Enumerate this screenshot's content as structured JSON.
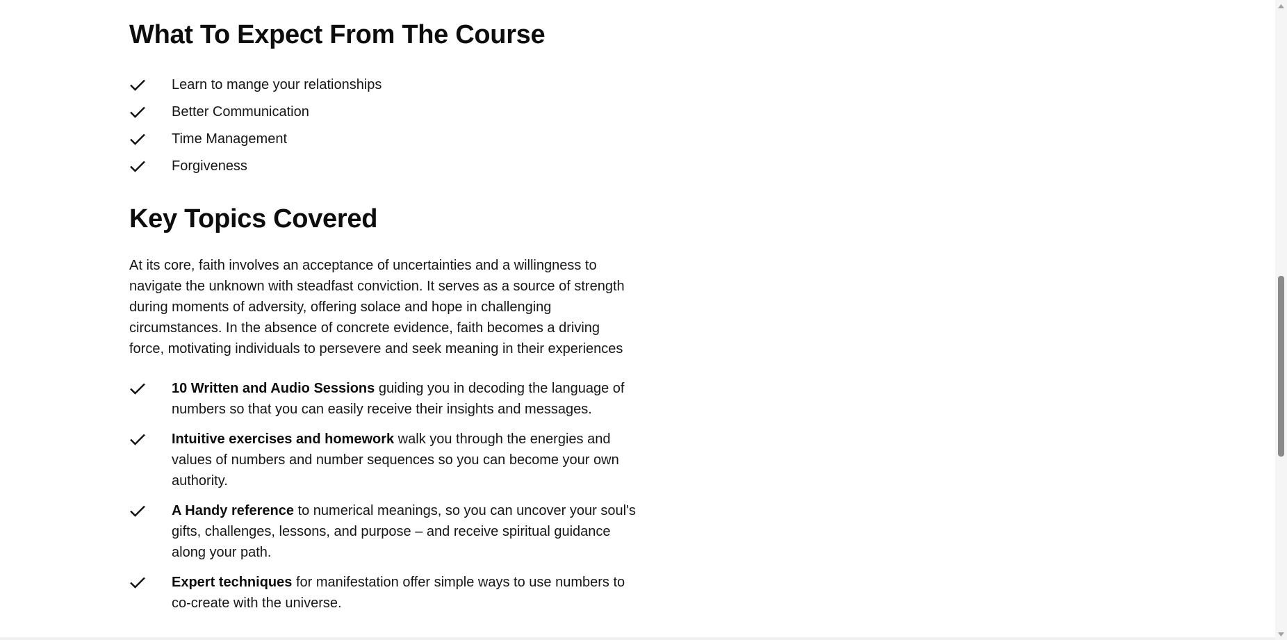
{
  "expect_section": {
    "title": "What To Expect From The Course",
    "items": [
      "Learn to mange your relationships",
      "Better Communication",
      "Time Management",
      "Forgiveness"
    ]
  },
  "topics_section": {
    "title": "Key Topics Covered",
    "intro": "At its core, faith involves an acceptance of uncertainties and a willingness to navigate the unknown with steadfast conviction. It serves as a source of strength during moments of adversity, offering solace and hope in challenging circumstances. In the absence of concrete evidence, faith becomes a driving force, motivating individuals to persevere and seek meaning in their experiences",
    "items": [
      {
        "bold": "10 Written and Audio Sessions",
        "text": " guiding you in decoding the language of numbers so that you can easily receive their insights and messages."
      },
      {
        "bold": "Intuitive exercises and homework",
        "text": " walk you through the energies and values of numbers and number sequences so you can become your own authority."
      },
      {
        "bold": "A Handy reference",
        "text": " to numerical meanings, so you can uncover your soul's gifts, challenges, lessons, and purpose – and receive spiritual guidance along your path."
      },
      {
        "bold": "Expert techniques",
        "text": " for manifestation offer simple ways to use numbers to co-create with the universe."
      }
    ]
  },
  "icons": {
    "list_marker": "check-icon",
    "scroll_up": "arrow-up-icon",
    "scroll_down": "arrow-down-icon"
  },
  "colors": {
    "text": "#161616",
    "heading": "#0d0d0d",
    "scroll_thumb": "#8a8a8a"
  }
}
